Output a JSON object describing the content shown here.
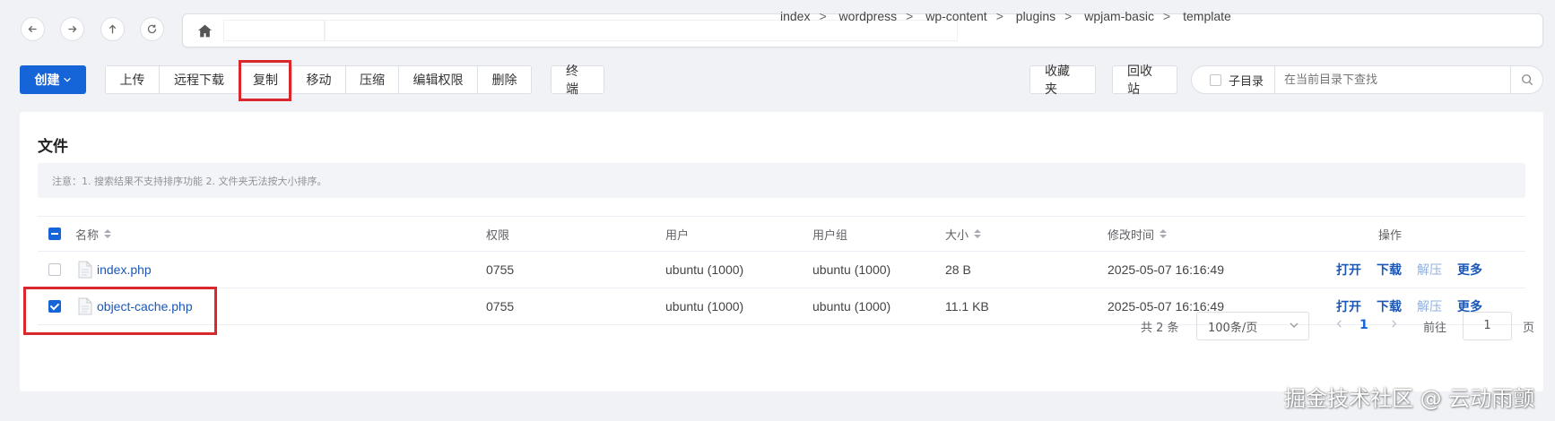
{
  "nav": {
    "back": "back-arrow",
    "forward": "forward-arrow",
    "up": "up-arrow",
    "refresh": "refresh"
  },
  "breadcrumb": {
    "items": [
      "index",
      "wordpress",
      "wp-content",
      "plugins",
      "wpjam-basic",
      "template"
    ],
    "separator": ">"
  },
  "toolbar": {
    "create_label": "创建",
    "group1": [
      "上传",
      "远程下载",
      "复制",
      "移动",
      "压缩",
      "编辑权限",
      "删除"
    ],
    "terminal_label": "终端",
    "favorites_label": "收藏夹",
    "recycle_label": "回收站",
    "subdir_label": "子目录",
    "search_placeholder": "在当前目录下查找"
  },
  "panel": {
    "title": "文件",
    "notice": "注意：1. 搜索结果不支持排序功能 2. 文件夹无法按大小排序。"
  },
  "table": {
    "headers": {
      "name": "名称",
      "perm": "权限",
      "user": "用户",
      "group": "用户组",
      "size": "大小",
      "mtime": "修改时间",
      "ops": "操作"
    },
    "rows": [
      {
        "name": "index.php",
        "perm": "0755",
        "user": "ubuntu (1000)",
        "group": "ubuntu (1000)",
        "size": "28 B",
        "mtime": "2025-05-07 16:16:49",
        "checked": false
      },
      {
        "name": "object-cache.php",
        "perm": "0755",
        "user": "ubuntu (1000)",
        "group": "ubuntu (1000)",
        "size": "11.1 KB",
        "mtime": "2025-05-07 16:16:49",
        "checked": true
      }
    ],
    "actions": [
      "打开",
      "下载",
      "解压",
      "更多"
    ]
  },
  "pagination": {
    "total": "共 2 条",
    "page_size": "100条/页",
    "current_page": "1",
    "goto_label": "前往",
    "goto_value": "1",
    "page_suffix": "页"
  },
  "watermark": "掘金技术社区 @ 云动雨颤",
  "colors": {
    "primary": "#1665d8",
    "highlight": "#d9272e",
    "link": "#1a57b8",
    "disabled_link": "#8fb0dd"
  }
}
